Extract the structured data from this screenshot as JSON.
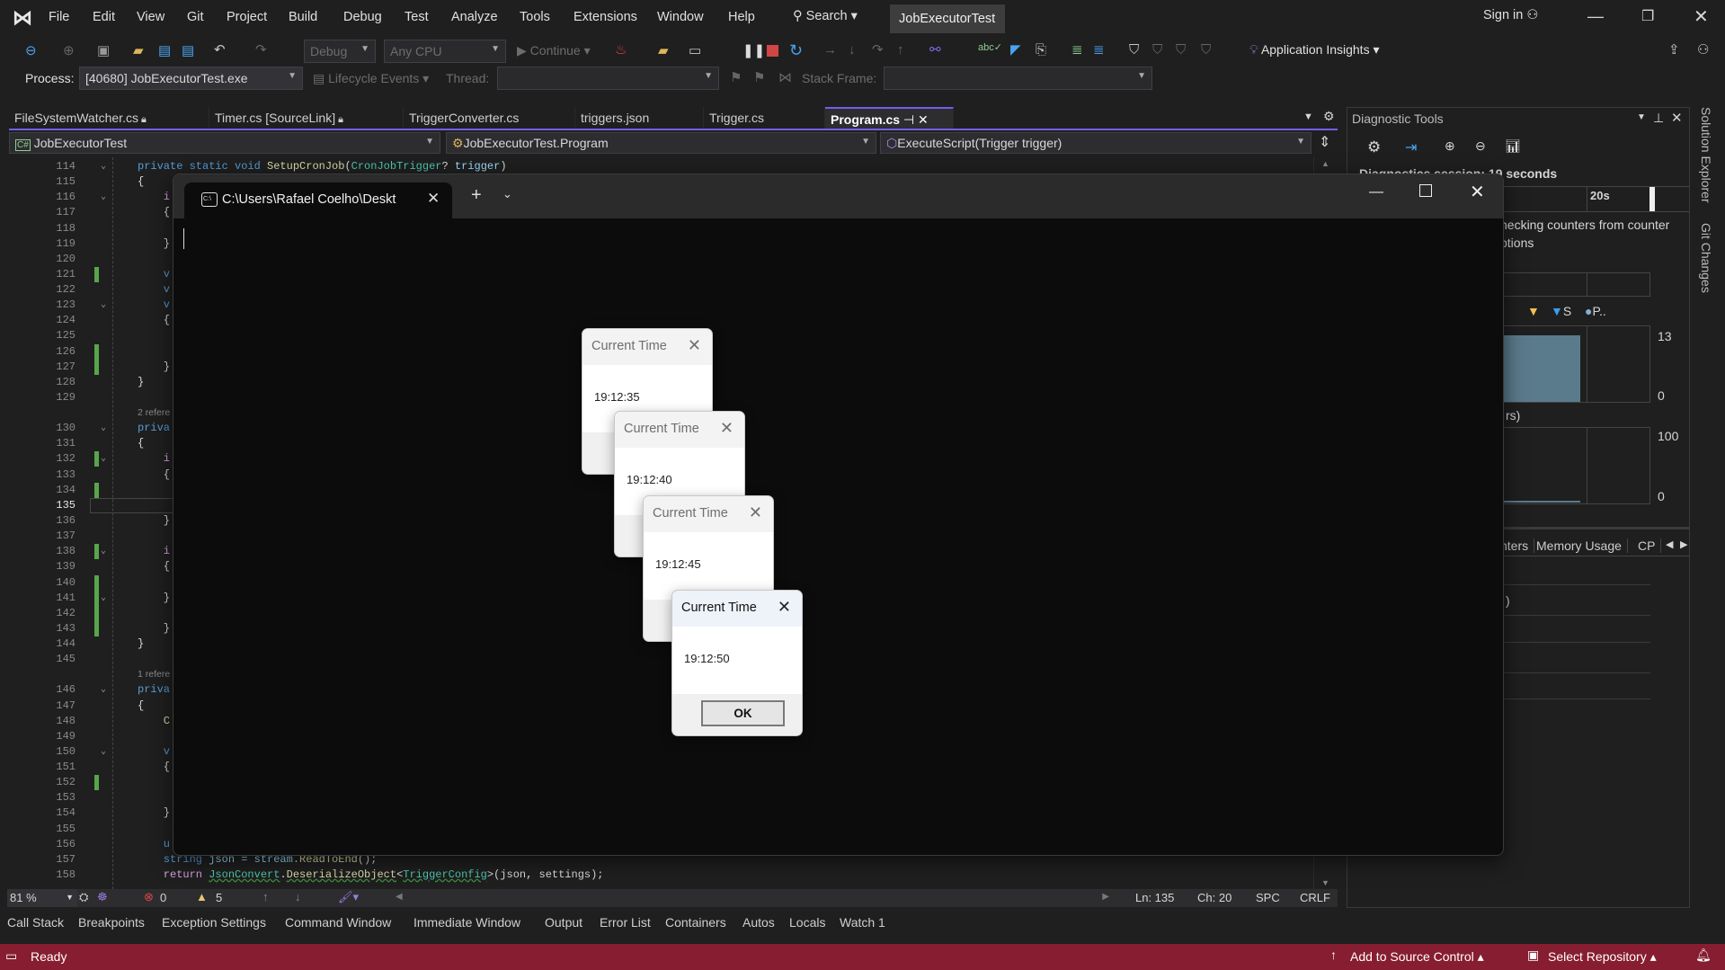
{
  "menu": {
    "items": [
      "File",
      "Edit",
      "View",
      "Git",
      "Project",
      "Build",
      "Debug",
      "Test",
      "Analyze",
      "Tools",
      "Extensions",
      "Window",
      "Help"
    ],
    "search": "Search",
    "solution": "JobExecutorTest",
    "sign_in": "Sign in"
  },
  "toolbar": {
    "config": "Debug",
    "platform": "Any CPU",
    "continue": "Continue",
    "app_insights": "Application Insights"
  },
  "debug_bar": {
    "process_label": "Process:",
    "process_value": "[40680] JobExecutorTest.exe",
    "lifecycle": "Lifecycle Events",
    "thread_label": "Thread:",
    "thread_value": "",
    "stack_label": "Stack Frame:",
    "stack_value": ""
  },
  "tabs": [
    {
      "label": "FileSystemWatcher.cs",
      "locked": true
    },
    {
      "label": "Timer.cs [SourceLink]",
      "locked": true
    },
    {
      "label": "TriggerConverter.cs"
    },
    {
      "label": "triggers.json"
    },
    {
      "label": "Trigger.cs"
    },
    {
      "label": "Program.cs",
      "active": true
    }
  ],
  "navbar": {
    "project": "JobExecutorTest",
    "type": "JobExecutorTest.Program",
    "member": "ExecuteScript(Trigger trigger)"
  },
  "code": {
    "current_line": 135,
    "changed_lines": [
      121,
      126,
      127,
      132,
      134,
      138,
      140,
      141,
      142,
      143,
      152
    ],
    "fold_lines": [
      114,
      116,
      123,
      130,
      132,
      138,
      141,
      146,
      150
    ],
    "lines": [
      {
        "n": 114,
        "tokens": [
          [
            "private static void ",
            "k"
          ],
          [
            "SetupCronJob",
            "m"
          ],
          [
            "(",
            "d"
          ],
          [
            "CronJobTrigger",
            "t"
          ],
          [
            "? ",
            "d"
          ],
          [
            "trigger",
            "p"
          ],
          [
            ")",
            "d"
          ]
        ]
      },
      {
        "n": 115,
        "tokens": [
          [
            "{",
            "d"
          ]
        ]
      },
      {
        "n": 116,
        "tokens": [
          [
            "    i",
            "c"
          ]
        ]
      },
      {
        "n": 117,
        "tokens": [
          [
            "    {",
            "d"
          ]
        ]
      },
      {
        "n": 118,
        "tokens": []
      },
      {
        "n": 119,
        "tokens": [
          [
            "    }",
            "d"
          ]
        ]
      },
      {
        "n": 120,
        "tokens": []
      },
      {
        "n": 121,
        "tokens": [
          [
            "    v",
            "k"
          ]
        ]
      },
      {
        "n": 122,
        "tokens": [
          [
            "    v",
            "k"
          ]
        ]
      },
      {
        "n": 123,
        "tokens": [
          [
            "    v",
            "k"
          ]
        ]
      },
      {
        "n": 124,
        "tokens": [
          [
            "    {",
            "d"
          ]
        ]
      },
      {
        "n": 125,
        "tokens": []
      },
      {
        "n": 126,
        "tokens": []
      },
      {
        "n": 127,
        "tokens": [
          [
            "    }",
            "d"
          ]
        ]
      },
      {
        "n": 128,
        "tokens": [
          [
            "}",
            "d"
          ]
        ]
      },
      {
        "n": 129,
        "tokens": []
      },
      {
        "lens": "2 refere"
      },
      {
        "n": 130,
        "tokens": [
          [
            "priva",
            "k"
          ]
        ]
      },
      {
        "n": 131,
        "tokens": [
          [
            "{",
            "d"
          ]
        ]
      },
      {
        "n": 132,
        "tokens": [
          [
            "    i",
            "c"
          ]
        ]
      },
      {
        "n": 133,
        "tokens": [
          [
            "    {",
            "d"
          ]
        ]
      },
      {
        "n": 134,
        "tokens": []
      },
      {
        "n": 135,
        "tokens": []
      },
      {
        "n": 136,
        "tokens": [
          [
            "    }",
            "d"
          ]
        ]
      },
      {
        "n": 137,
        "tokens": []
      },
      {
        "n": 138,
        "tokens": [
          [
            "    i",
            "c"
          ]
        ]
      },
      {
        "n": 139,
        "tokens": [
          [
            "    {",
            "d"
          ]
        ]
      },
      {
        "n": 140,
        "tokens": []
      },
      {
        "n": 141,
        "tokens": [
          [
            "    }",
            "d"
          ]
        ]
      },
      {
        "n": 142,
        "tokens": []
      },
      {
        "n": 143,
        "tokens": [
          [
            "    }",
            "d"
          ]
        ]
      },
      {
        "n": 144,
        "tokens": [
          [
            "}",
            "d"
          ]
        ]
      },
      {
        "n": 145,
        "tokens": []
      },
      {
        "lens": "1 refere"
      },
      {
        "n": 146,
        "tokens": [
          [
            "priva",
            "k"
          ]
        ]
      },
      {
        "n": 147,
        "tokens": [
          [
            "{",
            "d"
          ]
        ]
      },
      {
        "n": 148,
        "tokens": [
          [
            "    C",
            "m"
          ]
        ]
      },
      {
        "n": 149,
        "tokens": []
      },
      {
        "n": 150,
        "tokens": [
          [
            "    v",
            "k"
          ]
        ]
      },
      {
        "n": 151,
        "tokens": [
          [
            "    {",
            "d"
          ]
        ]
      },
      {
        "n": 152,
        "tokens": []
      },
      {
        "n": 153,
        "tokens": []
      },
      {
        "n": 154,
        "tokens": [
          [
            "    }",
            "d"
          ]
        ]
      },
      {
        "n": 155,
        "tokens": []
      },
      {
        "n": 156,
        "tokens": [
          [
            "    u",
            "k"
          ]
        ]
      },
      {
        "n": 157,
        "tokens": [
          [
            "    string",
            "k"
          ],
          [
            " json = stream.",
            "p"
          ],
          [
            "ReadToEnd",
            "m"
          ],
          [
            "();",
            "d"
          ]
        ]
      },
      {
        "n": 158,
        "tokens": [
          [
            "    return ",
            "c"
          ],
          [
            "JsonConvert",
            "t"
          ],
          [
            ".",
            "d"
          ],
          [
            "DeserializeObject",
            "m"
          ],
          [
            "<",
            "d"
          ],
          [
            "TriggerConfig",
            "t"
          ],
          [
            ">(json, settings);",
            "d"
          ]
        ]
      }
    ]
  },
  "editor_status": {
    "zoom": "81 %",
    "errors": "0",
    "warnings": "5",
    "line": "Ln: 135",
    "col": "Ch: 20",
    "whitespace": "SPC",
    "line_ending": "CRLF"
  },
  "bottom_tabs": [
    "Call Stack",
    "Breakpoints",
    "Exception Settings",
    "Command Window",
    "Immediate Window",
    "Output",
    "Error List",
    "Containers",
    "Autos",
    "Locals",
    "Watch 1"
  ],
  "status": {
    "ready": "Ready",
    "source_control": "Add to Source Control",
    "repository": "Select Repository"
  },
  "diagnostics": {
    "title": "Diagnostic Tools",
    "session": "Diagnostics session: 19 seconds",
    "timeline_tick": "20s",
    "message_1": "hecking counters from counter",
    "message_2": "ptions",
    "legend": [
      {
        "label": "",
        "color": "#f2c14e"
      },
      {
        "label": "S",
        "color": "#3b9cf0"
      },
      {
        "label": "P..",
        "color": "#7fb3d5"
      }
    ],
    "chart1": {
      "max": "13",
      "min": "0"
    },
    "chart2_title": "rs)",
    "chart2": {
      "max": "100",
      "min": "0"
    },
    "tabs": [
      "nters",
      "Memory Usage",
      "CP"
    ],
    "row_text": ")"
  },
  "side_tabs": [
    "Solution Explorer",
    "Git Changes"
  ],
  "terminal": {
    "tab_title": "C:\\Users\\Rafael Coelho\\Deskt"
  },
  "dialogs": [
    {
      "title": "Current Time",
      "time": "19:12:35"
    },
    {
      "title": "Current Time",
      "time": "19:12:40"
    },
    {
      "title": "Current Time",
      "time": "19:12:45"
    },
    {
      "title": "Current Time",
      "time": "19:12:50",
      "ok": "OK",
      "active": true
    }
  ],
  "colors": {
    "accent": "#7160e8",
    "status_bar": "#871d30",
    "change_marker": "#57a64a"
  }
}
